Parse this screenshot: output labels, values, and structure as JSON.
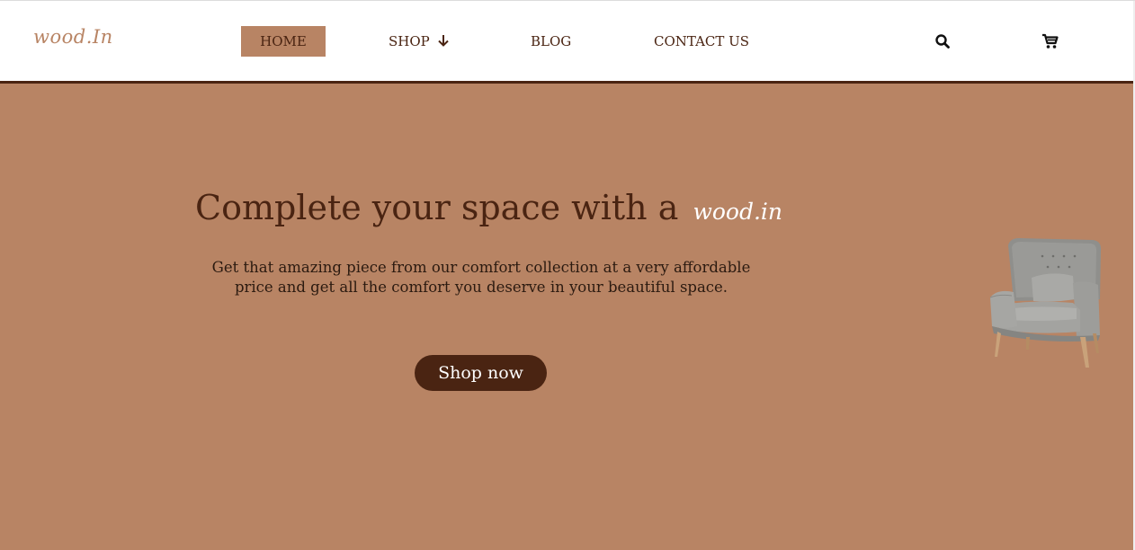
{
  "header": {
    "logo": "wood.In",
    "nav": {
      "home": "HOME",
      "shop": "SHOP",
      "blog": "BLOG",
      "contact": "CONTACT US"
    },
    "icons": {
      "search": "search-icon",
      "cart": "cart-icon",
      "shop_dropdown": "arrow-down-icon"
    }
  },
  "hero": {
    "title": "Complete your space with a",
    "brand": "wood.in",
    "description": "Get that amazing piece from our comfort collection at a very affordable price and get all the comfort you deserve in your beautiful space.",
    "cta": "Shop now"
  },
  "colors": {
    "accent": "#b88464",
    "dark_brown": "#4a2412",
    "white": "#ffffff"
  }
}
